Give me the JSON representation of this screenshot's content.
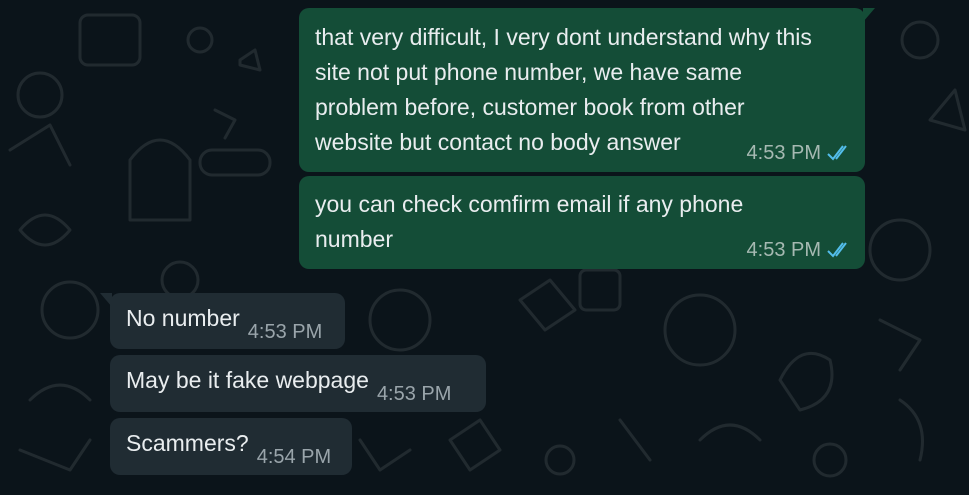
{
  "theme": {
    "background": "#0b141a",
    "outgoing_bubble": "#144d37",
    "incoming_bubble": "#202c33",
    "read_ticks": "#53bdeb"
  },
  "messages": [
    {
      "direction": "outgoing",
      "text": "that very difficult, I very dont understand why this site not put phone number, we have same problem before, customer book from other website but contact no body answer",
      "time": "4:53 PM",
      "status_icon": "double-check-read-icon"
    },
    {
      "direction": "outgoing",
      "text": "you can check comfirm email if any phone number",
      "time": "4:53 PM",
      "status_icon": "double-check-read-icon"
    },
    {
      "direction": "incoming",
      "text": "No number",
      "time": "4:53 PM"
    },
    {
      "direction": "incoming",
      "text": "May be it fake webpage",
      "time": "4:53 PM"
    },
    {
      "direction": "incoming",
      "text": "Scammers?",
      "time": "4:54 PM"
    }
  ]
}
